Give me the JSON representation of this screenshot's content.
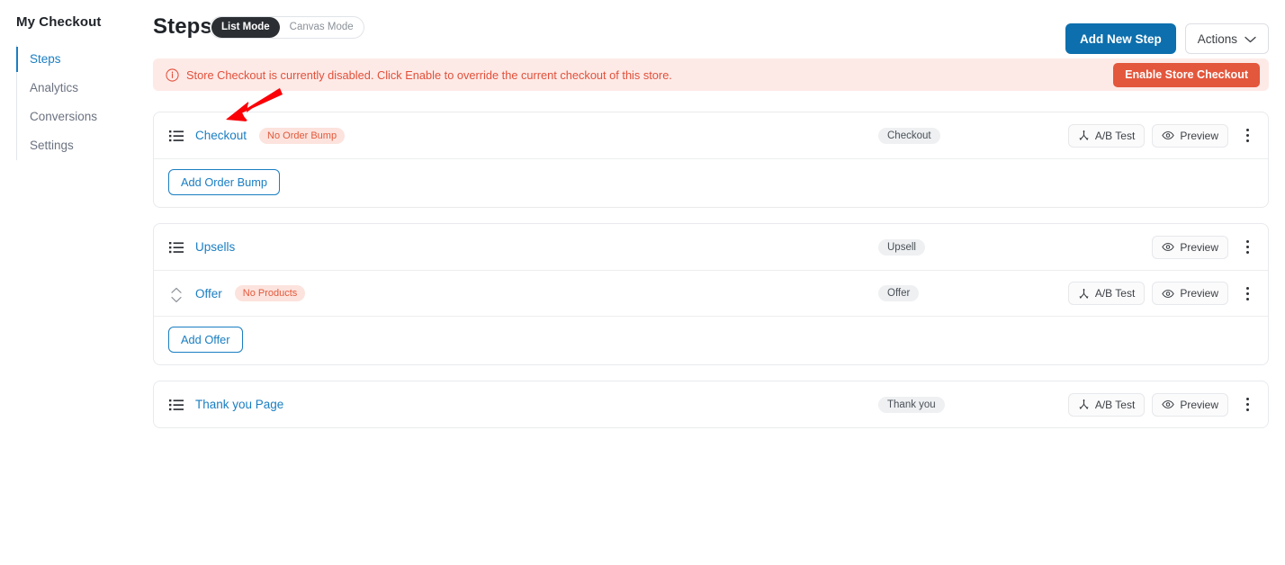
{
  "sidebar": {
    "brand": "My Checkout",
    "items": [
      {
        "label": "Steps",
        "name": "steps",
        "active": true
      },
      {
        "label": "Analytics",
        "name": "analytics",
        "active": false
      },
      {
        "label": "Conversions",
        "name": "conversions",
        "active": false
      },
      {
        "label": "Settings",
        "name": "settings",
        "active": false
      }
    ]
  },
  "header": {
    "title": "Steps",
    "mode_toggle": {
      "options": [
        "List Mode",
        "Canvas Mode"
      ],
      "selected": "List Mode"
    },
    "add_new_step": "Add New Step",
    "actions": "Actions"
  },
  "alert": {
    "icon": "info-circle-icon",
    "message": "Store Checkout is currently disabled. Click Enable to override the current checkout of this store.",
    "button": "Enable Store Checkout",
    "bg_color": "#fdeae7",
    "text_color": "#e2503a",
    "button_color": "#e3573c"
  },
  "colors": {
    "accent_blue": "#1a7ec2",
    "primary_button": "#0d6fad",
    "danger": "#e3573c",
    "badge_warning_bg": "#fce3dd",
    "tag_bg": "#eef0f2"
  },
  "actions_labels": {
    "ab_test": "A/B Test",
    "preview": "Preview"
  },
  "cards": [
    {
      "name": "checkout",
      "rows": [
        {
          "icon": "list-icon",
          "title": "Checkout",
          "badge": "No Order Bump",
          "type_tag": "Checkout",
          "has_ab_test": true,
          "has_preview": true,
          "has_menu": true
        }
      ],
      "footer_button": "Add Order Bump"
    },
    {
      "name": "upsells",
      "rows": [
        {
          "icon": "list-icon",
          "title": "Upsells",
          "badge": "",
          "type_tag": "Upsell",
          "has_ab_test": false,
          "has_preview": true,
          "has_menu": true
        },
        {
          "icon": "sort-handle-icon",
          "title": "Offer",
          "badge": "No Products",
          "type_tag": "Offer",
          "has_ab_test": true,
          "has_preview": true,
          "has_menu": true
        }
      ],
      "footer_button": "Add Offer"
    },
    {
      "name": "thank-you-page",
      "rows": [
        {
          "icon": "list-icon",
          "title": "Thank you Page",
          "badge": "",
          "type_tag": "Thank you",
          "has_ab_test": true,
          "has_preview": true,
          "has_menu": true
        }
      ],
      "footer_button": ""
    }
  ],
  "annotation": {
    "type": "arrow",
    "color": "#fb0007",
    "points_to": "Checkout step title"
  }
}
